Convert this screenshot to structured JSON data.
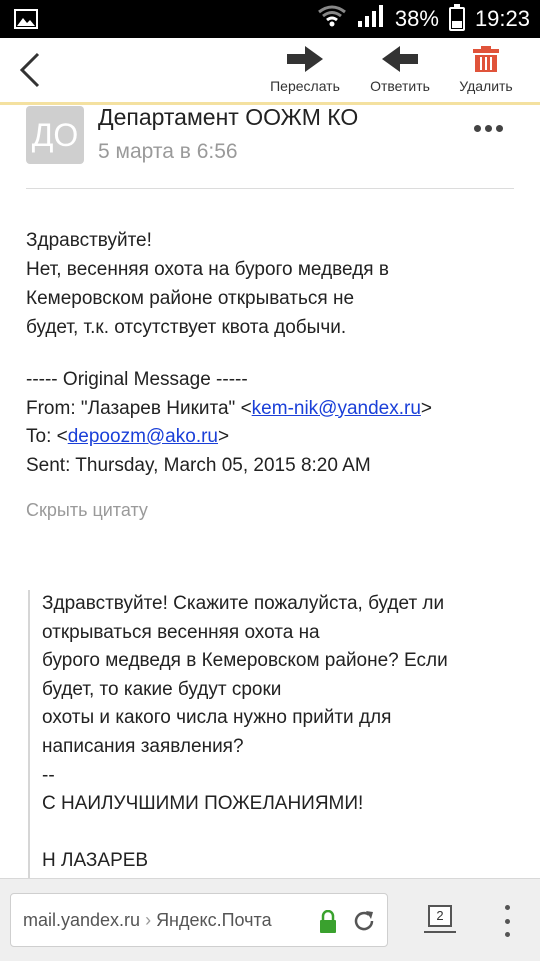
{
  "status_bar": {
    "battery": "38%",
    "time": "19:23",
    "battery_level_percent": 38,
    "icons": [
      "image-icon",
      "wifi-icon",
      "signal-icon",
      "battery-icon"
    ]
  },
  "toolbar": {
    "forward_label": "Переслать",
    "reply_label": "Ответить",
    "delete_label": "Удалить",
    "delete_color": "#e0533a"
  },
  "message": {
    "avatar_initials": "ДО",
    "sender": "Департамент ООЖМ КО",
    "date": "5 марта в 6:56",
    "body_lines": [
      "Здравствуйте!",
      "Нет, весенняя охота на бурого медведя в",
      "Кемеровском районе открываться не",
      "будет, т.к. отсутствует квота добычи."
    ],
    "original": {
      "header": "----- Original Message -----",
      "from_prefix": "From: \"Лазарев Никита\" <",
      "from_email": "kem-nik@yandex.ru",
      "from_suffix": ">",
      "to_prefix": "To: <",
      "to_email": "depoozm@ako.ru",
      "to_suffix": ">",
      "sent": "Sent: Thursday, March 05, 2015 8:20 AM"
    },
    "hide_quote_label": "Скрыть цитату",
    "quote_lines": [
      " Здравствуйте! Скажите пожалуйста, будет ли",
      "открываться весенняя охота на",
      " бурого медведя в Кемеровском районе? Если",
      "будет, то какие будут сроки",
      " охоты и какого числа нужно прийти для",
      "написания заявления?",
      " --",
      " С НАИЛУЧШИМИ ПОЖЕЛАНИЯМИ!",
      "",
      " Н ЛАЗАРЕВ"
    ]
  },
  "browser_bar": {
    "url_domain": "mail.yandex.ru",
    "url_separator": " › ",
    "url_title": "Яндекс.Почта",
    "tabs_count": "2",
    "lock_color": "#3aa12e"
  }
}
